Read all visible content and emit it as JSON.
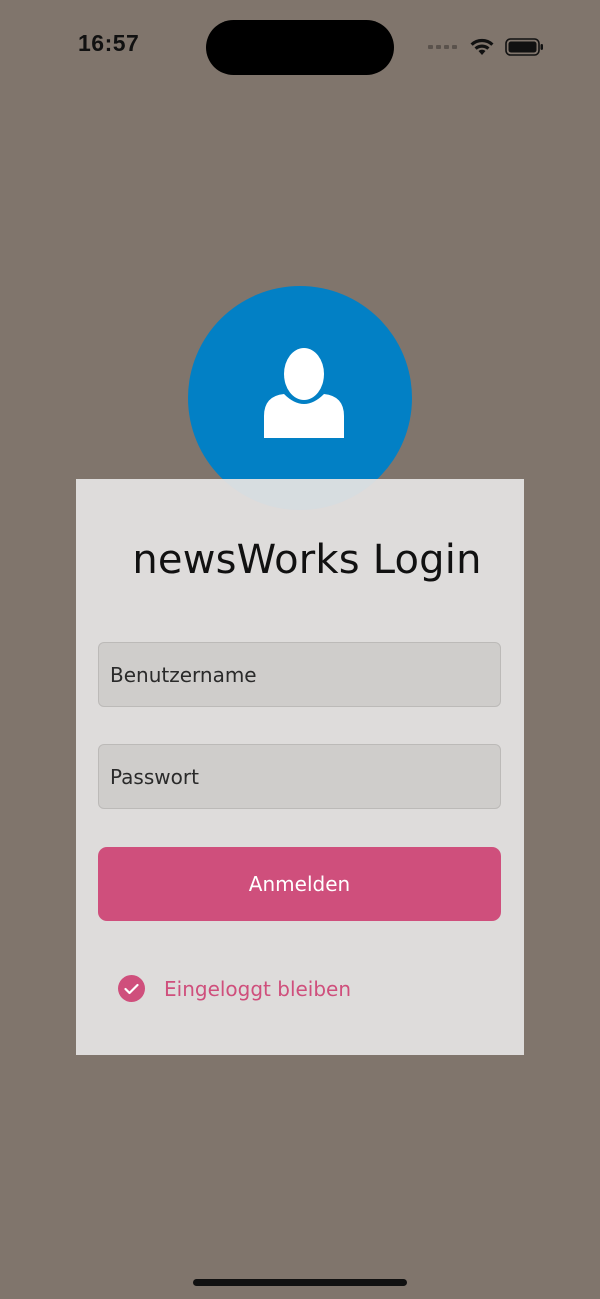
{
  "status_bar": {
    "time": "16:57"
  },
  "avatar": {
    "icon": "user-icon",
    "color": "#0280c5"
  },
  "login": {
    "title": "newsWorks Login",
    "username_placeholder": "Benutzername",
    "username_value": "",
    "password_placeholder": "Passwort",
    "password_value": "",
    "submit_label": "Anmelden",
    "remember_label": "Eingeloggt bleiben",
    "remember_checked": true,
    "accent_color": "#cf4f7c"
  },
  "colors": {
    "background": "#80756c",
    "card": "#e3e1e2",
    "field": "#cfcdcb"
  }
}
